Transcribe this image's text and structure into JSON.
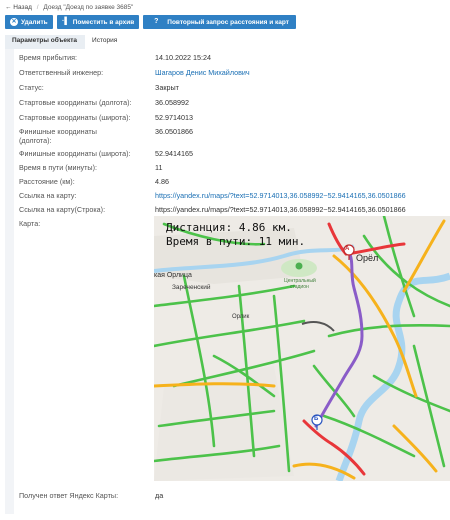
{
  "breadcrumb": {
    "back": "← Назад",
    "separator": "/",
    "current": "Доезд \"Доезд по заявке 3685\""
  },
  "toolbar": {
    "delete_label": "Удалить",
    "archive_label": "Поместить в архив",
    "repeat_label": "Повторный запрос расстояния и карт"
  },
  "tabs": [
    "Параметры объекта",
    "История"
  ],
  "fields": {
    "arrival_time": {
      "label": "Время прибытия:",
      "value": "14.10.2022 15:24"
    },
    "engineer": {
      "label": "Ответственный инженер:",
      "value": "Шагаров Денис Михайлович"
    },
    "status": {
      "label": "Статус:",
      "value": "Закрыт"
    },
    "start_lon": {
      "label": "Стартовые координаты (долгота):",
      "value": "36.058992"
    },
    "start_lat": {
      "label": "Стартовые координаты (широта):",
      "value": "52.9714013"
    },
    "finish_lon": {
      "label_line1": "Финишные координаты",
      "label_line2": "(долгота):",
      "value": "36.0501866"
    },
    "finish_lat": {
      "label": "Финишные координаты (широта):",
      "value": "52.9414165"
    },
    "travel_time": {
      "label": "Время в пути (минуты):",
      "value": "11"
    },
    "distance": {
      "label": "Расстояние (км):",
      "value": "4.86"
    },
    "map_link": {
      "label": "Ссылка на карту:",
      "value": "https://yandex.ru/maps/?text=52.9714013,36.058992~52.9414165,36.0501866"
    },
    "map_link_string": {
      "label": "Ссылка на карту(Строка):",
      "value": "https://yandex.ru/maps/?text=52.9714013,36.058992~52.9414165,36.0501866"
    },
    "map": {
      "label": "Карта:"
    },
    "yandex_response": {
      "label": "Получен ответ Яндекс Карты:",
      "value": "да"
    }
  },
  "map": {
    "distance_text": "Дистанция: 4.86 км.",
    "time_text": "Время в пути: 11 мин.",
    "city_label": "Орёл",
    "river_label": "Орлица",
    "district_label": "Зареченский",
    "stadium_label_1": "Центральный",
    "stadium_label_2": "стадион",
    "locality_label": "Орлик",
    "river2_label": "кая Орлица",
    "marker_a": "A",
    "marker_b": "Б"
  },
  "colors": {
    "button_blue": "#2f80c4",
    "link_blue": "#1a6fb4",
    "traffic_green": "#4cc24a",
    "traffic_yellow": "#f6b21c",
    "traffic_red": "#e8363a",
    "route_purple": "#8a5cc8"
  }
}
